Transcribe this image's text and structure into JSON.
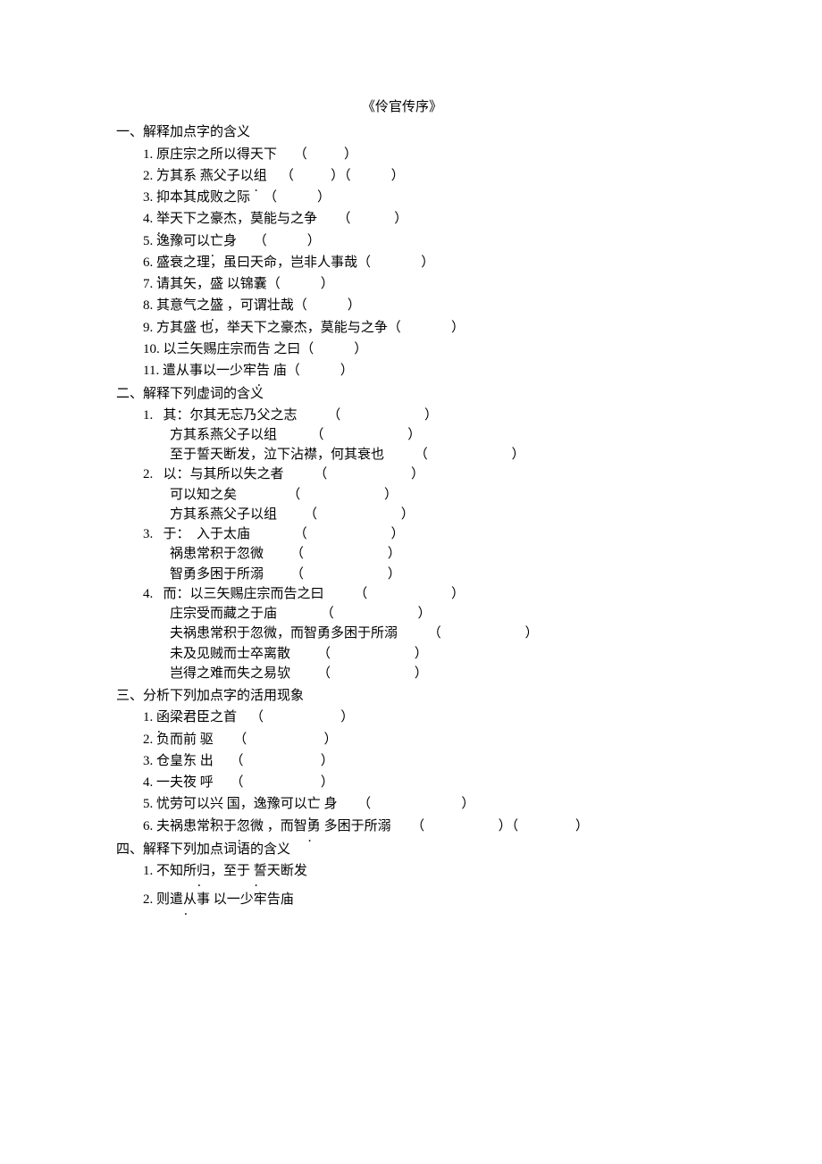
{
  "title": "《伶官传序》",
  "sections": {
    "s1": {
      "head": "一、解释加点字的含义",
      "items": {
        "i1": {
          "num": "1.",
          "pre": "",
          "dot": "原",
          "post": "庄宗之所以得天下     （           ）"
        },
        "i2": {
          "num": "2.",
          "pre": "方其",
          "dot": "系",
          "mid": " 燕父子以",
          "dot2": "组",
          "post": "    （           ）（            ）"
        },
        "i3": {
          "num": "3.",
          "pre": "",
          "dot": "抑",
          "post": "本其成败之际    （            ）"
        },
        "i4": {
          "num": "4.",
          "pre": "",
          "dot": "举",
          "post": "天下之豪杰，莫能与之争      （             ）"
        },
        "i5": {
          "num": "5.",
          "pre": "逸豫可以",
          "dot": "亡",
          "post": "身     （            ）"
        },
        "i6": {
          "num": "6.",
          "pre": "",
          "dot": "盛",
          "post": "衰之理，虽曰天命，岂非人事哉（               ）"
        },
        "i7": {
          "num": "7.",
          "pre": "请其矢，",
          "dot": "盛",
          "post": " 以锦囊（            ）"
        },
        "i8": {
          "num": "8.",
          "pre": "其意气之",
          "dot": "盛",
          "post": " ，可谓壮哉（            ）"
        },
        "i9": {
          "num": "9.",
          "pre": "方其",
          "dot": "盛",
          "post": " 也，举天下之豪杰，莫能与之争（               ）"
        },
        "i10": {
          "num": "10.",
          "pre": "以三矢赐庄宗而",
          "dot": "告",
          "post": " 之曰（            ）"
        },
        "i11": {
          "num": "11.",
          "pre": "遣从事以一少牢",
          "dot": "告",
          "post": " 庙（            ）"
        }
      }
    },
    "s2": {
      "head": "二、解释下列虚词的含义",
      "groups": {
        "g1": {
          "label": "1.   其：",
          "l1": "尔其无忘乃父之志         （                         ）",
          "l2": "方其系燕父子以组          （                         ）",
          "l3": "至于誓天断发，泣下沾襟，何其衰也         （                         ）"
        },
        "g2": {
          "label": "2.   以：",
          "l1": "与其所以失之者         （                         ）",
          "l2": "可以知之矣               （                         ）",
          "l3": "方其系燕父子以组        （                         ）"
        },
        "g3": {
          "label": "3.   于：",
          "l1": "  入于太庙             （                         ）",
          "l2": "祸患常积于忽微        （                         ）",
          "l3": "智勇多困于所溺        （                         ）"
        },
        "g4": {
          "label": "4.   而：",
          "l1": "以三矢赐庄宗而告之曰         （                         ）",
          "l2": "庄宗受而藏之于庙             （                         ）",
          "l3": "夫祸患常积于忽微，而智勇多困于所溺         （                         ）",
          "l4": "未及见贼而士卒离散        （                         ）",
          "l5": "岂得之难而失之易欤        （                         ）"
        }
      }
    },
    "s3": {
      "head": "三、分析下列加点字的活用现象",
      "items": {
        "i1": {
          "num": "1.",
          "pre": "",
          "dot": "函",
          "post": "梁君臣之首    （                       ）"
        },
        "i2": {
          "num": "2.",
          "pre": "负而",
          "dot": "前",
          "post": " 驱      （                       ）"
        },
        "i3": {
          "num": "3.",
          "pre": "仓皇",
          "dot": "东",
          "post": " 出     （                       ）"
        },
        "i4": {
          "num": "4.",
          "pre": "一夫",
          "dot": "夜",
          "post": " 呼     （                       ）"
        },
        "i5": {
          "num": "5.",
          "pre": "忧劳可以",
          "dot": "兴",
          "mid": " 国，逸豫可以",
          "dot2": "亡",
          "post": " 身      （                           ）"
        },
        "i6": {
          "num": "6.",
          "pre": "夫祸患常积于",
          "dot": "忽微",
          "mid": " ，而智",
          "dot2": "勇",
          "post": " 多困于所溺      （                      ）（                 ）"
        }
      }
    },
    "s4": {
      "head": "四、解释下列加点词语的含义",
      "items": {
        "i1": {
          "num": "1.",
          "pre": "不知所",
          "dot": "归",
          "mid": "，至于 ",
          "dot2": "誓天",
          "post": "断发"
        },
        "i2": {
          "num": "2.",
          "pre": "则遣",
          "dot": "从事",
          "post": " 以一少牢告庙"
        }
      }
    }
  }
}
